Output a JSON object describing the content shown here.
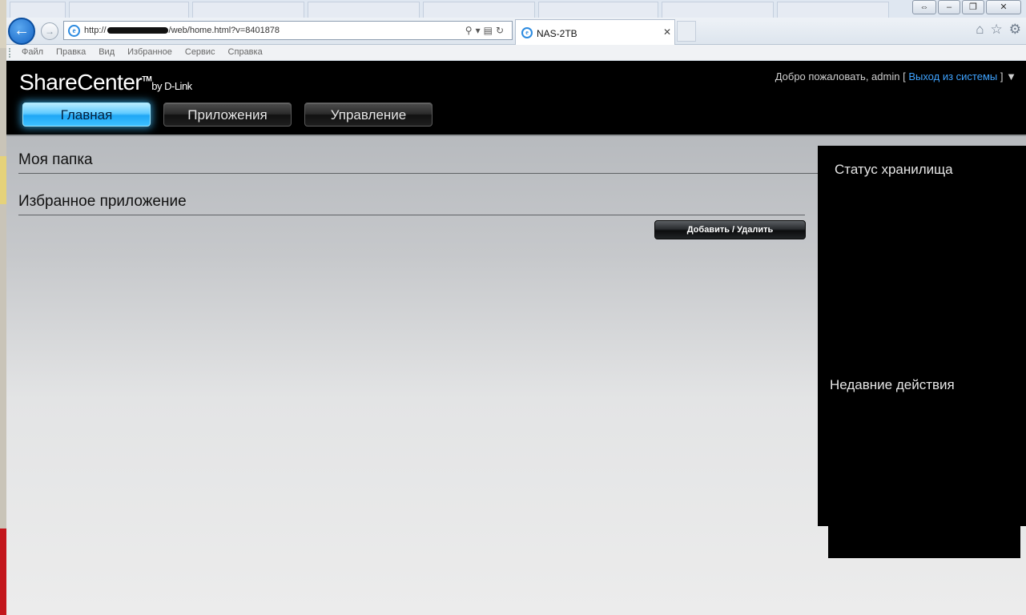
{
  "browser": {
    "url_prefix": "http://",
    "url_suffix": "/web/home.html?v=8401878",
    "tab_title": "NAS-2TB",
    "menu": [
      "Файл",
      "Правка",
      "Вид",
      "Избранное",
      "Сервис",
      "Справка"
    ]
  },
  "app": {
    "logo": "ShareCenter",
    "logo_tm": "TM",
    "logo_by": "by D-Link",
    "welcome_prefix": "Добро пожаловать, admin [",
    "logout_label": "Выход из системы",
    "welcome_suffix": "]"
  },
  "nav": {
    "tabs": [
      {
        "label": "Главная",
        "active": true
      },
      {
        "label": "Приложения",
        "active": false
      },
      {
        "label": "Управление",
        "active": false
      }
    ]
  },
  "main": {
    "my_folder_title": "Моя папка",
    "fav_apps_title": "Избранное приложение",
    "add_remove_label": "Добавить / Удалить"
  },
  "sidebar": {
    "storage_status_title": "Статус хранилища",
    "recent_actions_title": "Недавние действия"
  },
  "colors": {
    "accent": "#1fa7f5",
    "link": "#3fa3ff",
    "header_bg": "#000000"
  }
}
